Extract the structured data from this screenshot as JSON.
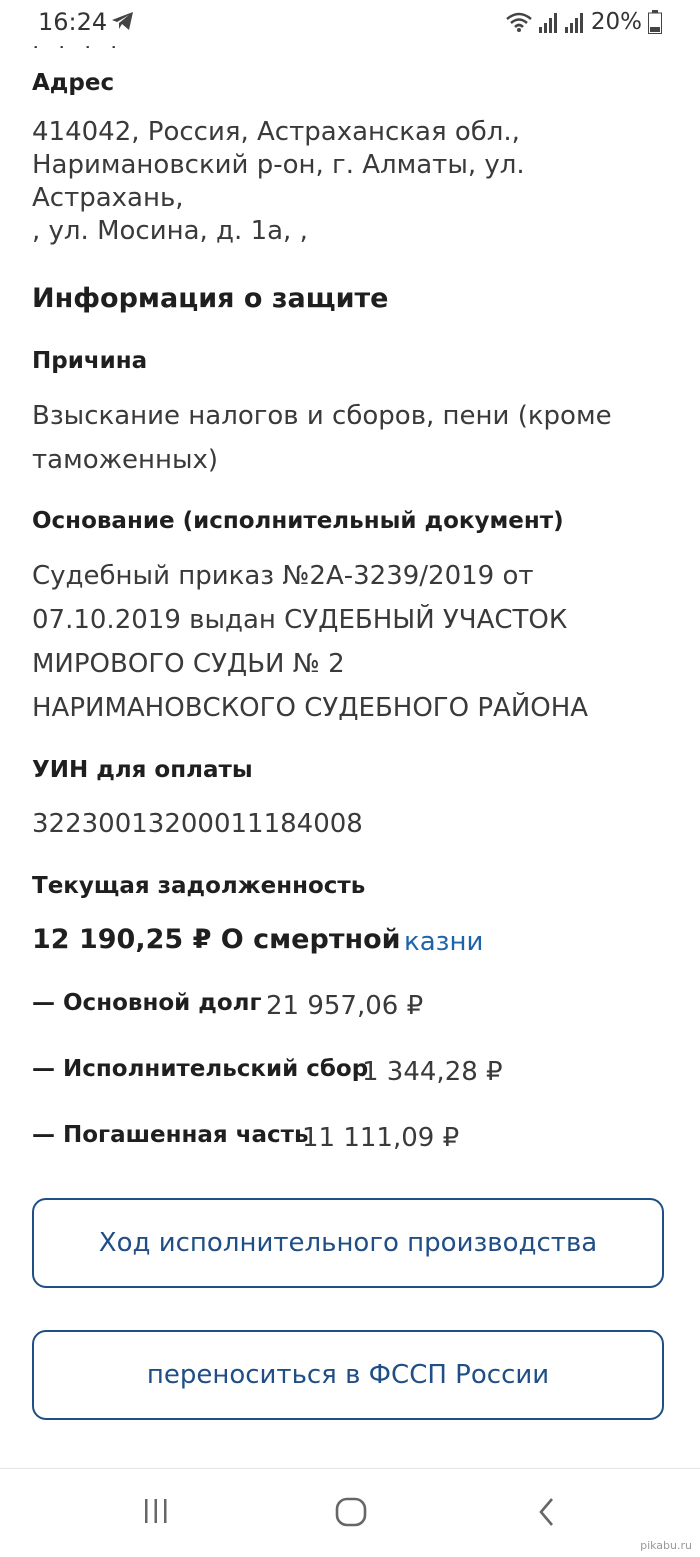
{
  "status_bar": {
    "time": "16:24",
    "battery": "20%",
    "icons": [
      "telegram-icon",
      "wifi-icon",
      "signal-icon",
      "battery-icon"
    ]
  },
  "address": {
    "label": "Адрес",
    "lines": [
      "414042, Россия, Астраханская обл.,",
      "Наримановский р-он, г. Алматы, ул. Астрахань,",
      ", ул. Мосина, д. 1а, ,"
    ]
  },
  "protection": {
    "title": "Информация о защите",
    "reason_label": "Причина",
    "reason_lines": [
      "Взыскание налогов и сборов, пени (кроме",
      "таможенных)"
    ],
    "basis_label": "Основание (исполнительный документ)",
    "basis_lines": [
      "Судебный приказ №2А-3239/2019 от",
      "07.10.2019 выдан СУДЕБНЫЙ УЧАСТОК",
      "МИРОВОГО СУДЬИ № 2",
      "НАРИМАНОВСКОГО СУДЕБНОГО РАЙОНА"
    ],
    "uin_label": "УИН для оплаты",
    "uin_value": "32230013200011184008",
    "debt_label": "Текущая задолженность",
    "debt_amount": "12 190,25 ₽ О смертной",
    "debt_link": "казни",
    "rows": [
      {
        "label": "— Основной долг",
        "value": "21 957,06 ₽"
      },
      {
        "label": "— Исполнительский сбор",
        "value": "1 344,28 ₽"
      },
      {
        "label": "— Погашенная часть",
        "value": "11 111,09 ₽"
      }
    ]
  },
  "buttons": {
    "progress": "Ход исполнительного производства",
    "fssp": "переноситься в ФССП России"
  },
  "nav": {
    "icons": [
      "recent-apps-icon",
      "home-icon",
      "back-icon"
    ]
  },
  "watermark": "pikabu.ru",
  "colors": {
    "link": "#1e64a8",
    "button_border": "#1f4f86"
  }
}
